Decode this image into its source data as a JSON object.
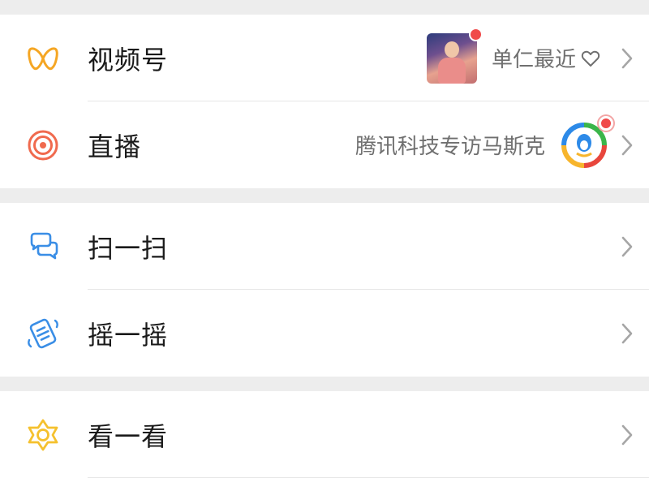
{
  "items": [
    {
      "title": "视频号",
      "icon": "channels-icon",
      "subtitle": "单仁最近",
      "has_heart": true,
      "has_thumbnail": true
    },
    {
      "title": "直播",
      "icon": "live-icon",
      "subtitle": "腾讯科技专访马斯克",
      "has_avatar": true
    },
    {
      "title": "扫一扫",
      "icon": "scan-icon"
    },
    {
      "title": "摇一摇",
      "icon": "shake-icon"
    },
    {
      "title": "看一看",
      "icon": "top-stories-icon"
    }
  ],
  "colors": {
    "channels": "#f5a623",
    "live": "#f06a4e",
    "scan": "#3a8ee6",
    "shake": "#3a8ee6",
    "top_stories": "#f5c12e",
    "badge": "#f04a4a"
  }
}
